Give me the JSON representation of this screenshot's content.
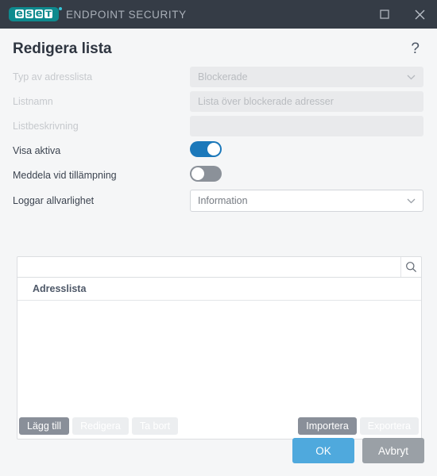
{
  "titlebar": {
    "logo_text": "eset",
    "app_name": "ENDPOINT SECURITY",
    "maximize_icon": "maximize-icon",
    "close_icon": "close-icon"
  },
  "dialog": {
    "title": "Redigera lista",
    "help_label": "?"
  },
  "form": {
    "rows": [
      {
        "label": "Typ av adresslista",
        "type": "select",
        "value": "Blockerade",
        "disabled": true
      },
      {
        "label": "Listnamn",
        "type": "text",
        "value": "Lista över blockerade adresser",
        "disabled": true
      },
      {
        "label": "Listbeskrivning",
        "type": "text",
        "value": "",
        "disabled": true
      },
      {
        "label": "Visa aktiva",
        "type": "toggle",
        "state": "on"
      },
      {
        "label": "Meddela vid tillämpning",
        "type": "toggle",
        "state": "off"
      },
      {
        "label": "Loggar allvarlighet",
        "type": "select",
        "value": "Information",
        "disabled": false
      }
    ]
  },
  "list_panel": {
    "search": {
      "value": "",
      "placeholder": "",
      "icon": "search-icon"
    },
    "columns": [
      "Adresslista"
    ],
    "rows": [],
    "toolbar": {
      "left": [
        {
          "label": "Lägg till",
          "enabled": true
        },
        {
          "label": "Redigera",
          "enabled": false
        },
        {
          "label": "Ta bort",
          "enabled": false
        }
      ],
      "right": [
        {
          "label": "Importera",
          "enabled": true
        },
        {
          "label": "Exportera",
          "enabled": false
        }
      ]
    }
  },
  "footer": {
    "ok_label": "OK",
    "cancel_label": "Avbryt"
  },
  "colors": {
    "titlebar_bg": "#353c46",
    "logo_teal": "#0e8a8e",
    "toggle_on": "#1b78ba",
    "toggle_off": "#8b9199",
    "primary_button": "#4fa9dd",
    "secondary_button": "#9aa0a6",
    "body_bg": "#f5f6f7"
  }
}
